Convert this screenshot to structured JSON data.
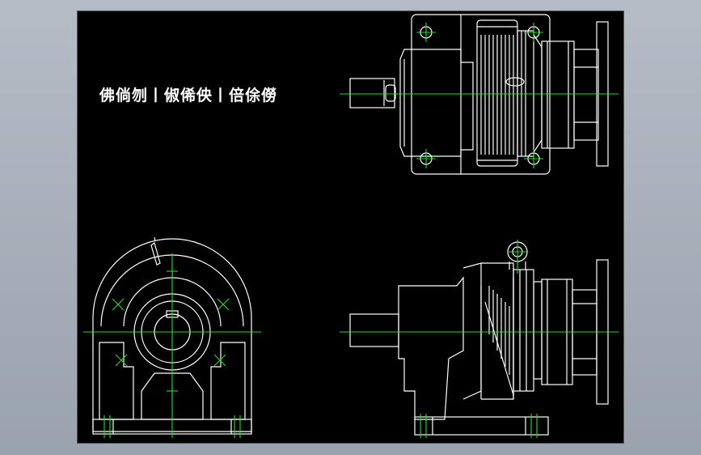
{
  "drawing": {
    "title": "佛倘刎丨俶俙佒丨倍俆僗",
    "colors": {
      "background": "#000000",
      "outline": "#ffffff",
      "centerline": "#22dd22",
      "frame": "#a9b1bb"
    },
    "views": [
      "top-view",
      "side-view",
      "front-view"
    ]
  }
}
